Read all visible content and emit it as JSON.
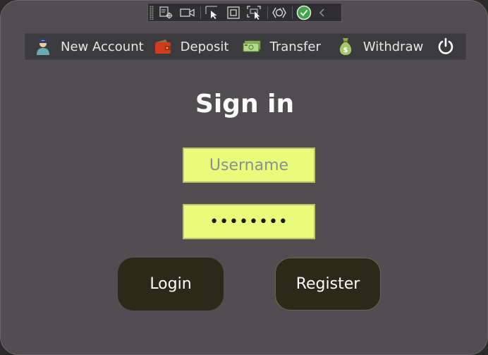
{
  "debug_toolbar": {
    "buttons": [
      "select-element-icon",
      "video-icon",
      "pointer-select-icon",
      "frame-icon",
      "track-focus-icon",
      "hot-reload-icon",
      "check-icon",
      "collapse-icon"
    ]
  },
  "menubar": {
    "items": [
      {
        "label": "New Account",
        "icon": "user-icon"
      },
      {
        "label": "Deposit",
        "icon": "wallet-icon"
      },
      {
        "label": "Transfer",
        "icon": "cash-icon"
      },
      {
        "label": "Withdraw",
        "icon": "money-bag-icon"
      }
    ],
    "power_icon": "power-icon"
  },
  "signin": {
    "title": "Sign in",
    "username_placeholder": "Username",
    "username_value": "",
    "password_value": "••••••••",
    "login_label": "Login",
    "register_label": "Register"
  },
  "colors": {
    "window_bg": "#524d50",
    "menubar_bg": "#3b3a3c",
    "field_bg": "#e8fb7a",
    "button_bg": "#2b2a1a"
  }
}
